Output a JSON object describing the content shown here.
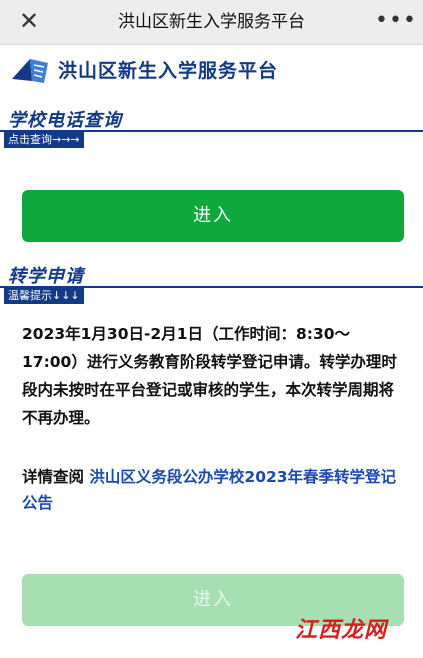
{
  "window": {
    "title": "洪山区新生入学服务平台",
    "close_icon": "close-icon",
    "more_icon": "more-icon"
  },
  "brand": {
    "name": "洪山区新生入学服务平台",
    "accent_color": "#123a86"
  },
  "school_phone": {
    "title": "学校电话查询",
    "tag": "点击查询→→→",
    "button_label": "进入"
  },
  "transfer": {
    "title": "转学申请",
    "tag": "温馨提示↓↓↓",
    "notice": "2023年1月30日-2月1日（工作时间：8:30～17:00）进行义务教育阶段转学登记申请。转学办理时段内未按时在平台登记或审核的学生，本次转学周期将不再办理。",
    "details_prefix": "详情查阅 ",
    "details_link": "洪山区义务段公办学校2023年春季转学登记公告",
    "button_label": "进入"
  },
  "watermark": "江西龙网",
  "colors": {
    "primary_button": "#0ea83c",
    "disabled_button": "#a6dfb2",
    "link": "#1a49b0"
  }
}
